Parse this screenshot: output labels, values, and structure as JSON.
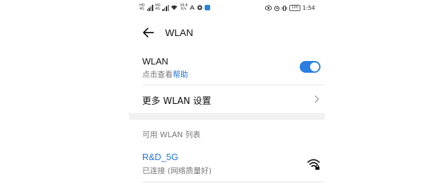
{
  "status_bar": {
    "left_tags": [
      "HD",
      "4G"
    ],
    "net_speed_value": "39.8",
    "net_speed_unit": "K/s",
    "battery": "100",
    "time": "1:54"
  },
  "header": {
    "title": "WLAN"
  },
  "wlan_toggle": {
    "title": "WLAN",
    "subtitle_prefix": "点击查看",
    "subtitle_link": "帮助",
    "enabled": true
  },
  "more_settings": {
    "label": "更多 WLAN 设置"
  },
  "available_list": {
    "section_title": "可用 WLAN 列表",
    "networks": [
      {
        "name": "R&D_5G",
        "status": "已连接 (网络质量好)",
        "icon": "wifi-locked-icon"
      }
    ]
  },
  "colors": {
    "accent": "#2a7fe0",
    "link": "#1a73d6",
    "band": "#f1f1f1"
  }
}
